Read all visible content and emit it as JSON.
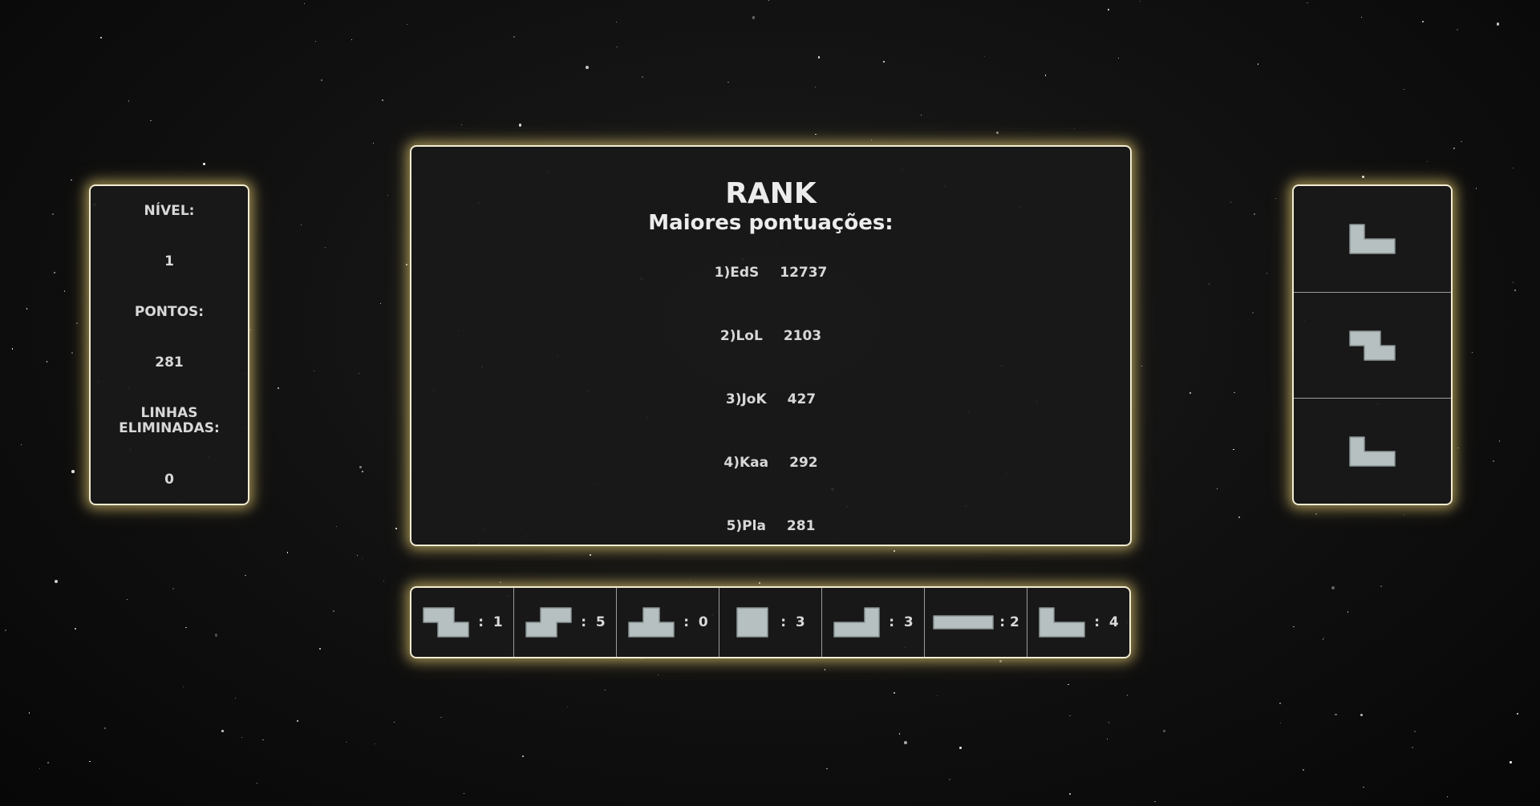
{
  "colors": {
    "accent": "#f3ecd2",
    "glow": "#ead278",
    "piece": "#b7c0c0"
  },
  "stats": [
    {
      "key": "nivel",
      "label": "NÍVEL:",
      "value": "1"
    },
    {
      "key": "pontos",
      "label": "PONTOS:",
      "value": "281"
    },
    {
      "key": "linhas",
      "label": "LINHAS ELIMINADAS:",
      "value": "0"
    }
  ],
  "rank": {
    "title": "RANK",
    "subtitle": "Maiores pontuações:",
    "entries": [
      {
        "name": "1)EdS",
        "score": "12737"
      },
      {
        "name": "2)LoL",
        "score": "2103"
      },
      {
        "name": "3)JoK",
        "score": "427"
      },
      {
        "name": "4)Kaa",
        "score": "292"
      },
      {
        "name": "5)Pla",
        "score": "281"
      }
    ]
  },
  "next_pieces": [
    "L-piece-icon",
    "Z-piece-icon",
    "L-piece-icon"
  ],
  "piece_counts": [
    {
      "icon": "Z-piece-icon",
      "separator": ":",
      "count": "1"
    },
    {
      "icon": "S-piece-icon",
      "separator": ":",
      "count": "5"
    },
    {
      "icon": "T-piece-icon",
      "separator": ":",
      "count": "0"
    },
    {
      "icon": "O-piece-icon",
      "separator": ":",
      "count": "3"
    },
    {
      "icon": "J-piece-icon",
      "separator": ":",
      "count": "3"
    },
    {
      "icon": "I-piece-icon",
      "separator": ":",
      "count": "2"
    },
    {
      "icon": "L-piece-icon",
      "separator": ":",
      "count": "4"
    }
  ]
}
